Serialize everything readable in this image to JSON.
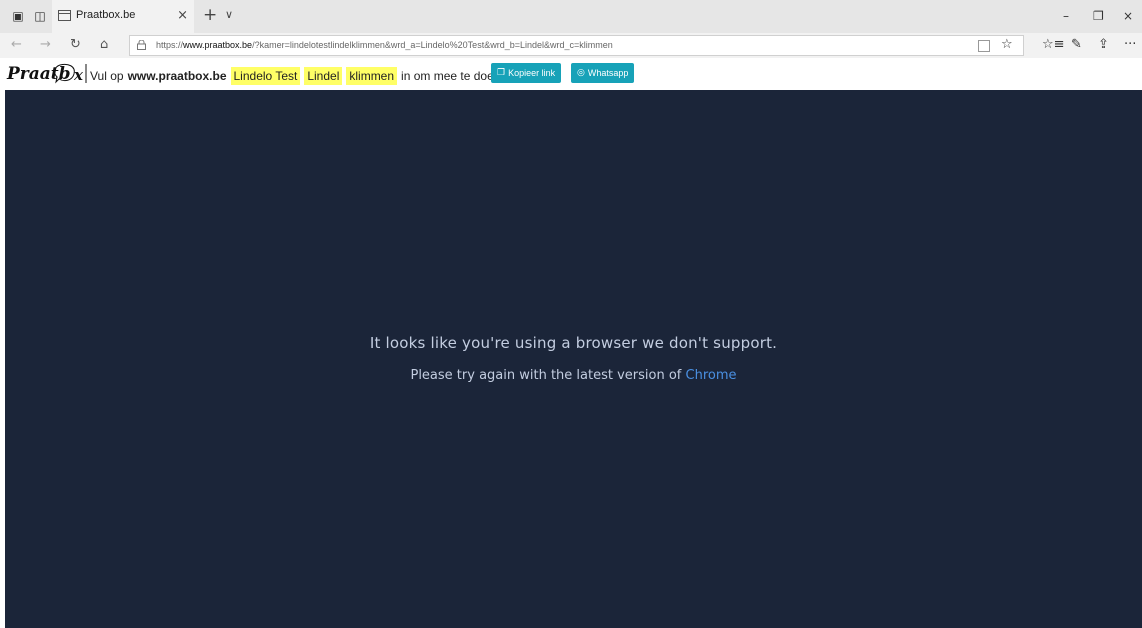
{
  "browser": {
    "tab_title": "Praatbox.be",
    "tab_close": "×",
    "new_tab": "+",
    "tab_list": "∨",
    "window_controls": {
      "minimize": "–",
      "restore": "❐",
      "close": "×"
    },
    "nav": {
      "back": "←",
      "forward": "→",
      "refresh": "↻",
      "home": "⌂"
    },
    "url_prefix": "https://",
    "url_domain": "www.praatbox.be",
    "url_rest": "/?kamer=lindelotestlindelklimmen&wrd_a=Lindelo%20Test&wrd_b=Lindel&wrd_c=klimmen",
    "favorite_star": "☆",
    "toolbar": {
      "favorites": "☆≡",
      "notes": "✎",
      "share": "⇪",
      "more": "···"
    }
  },
  "banner": {
    "logo_text": "Praatb",
    "logo_tail": "x",
    "text_start": "Vul op",
    "site": "www.praatbox.be",
    "words": [
      "Lindelo Test",
      "Lindel",
      "klimmen"
    ],
    "text_end": "in om mee te doen.",
    "copy_button": "Kopieer link",
    "whatsapp_button": "Whatsapp"
  },
  "main": {
    "message": "It looks like you're using a browser we don't support.",
    "sub_message": "Please try again with the latest version of",
    "browser_link": "Chrome"
  },
  "colors": {
    "background_dark": "#1b2539",
    "text_light": "#c3cde0",
    "link": "#4a90e2",
    "highlight": "#ffff66",
    "button": "#17a2b8"
  }
}
